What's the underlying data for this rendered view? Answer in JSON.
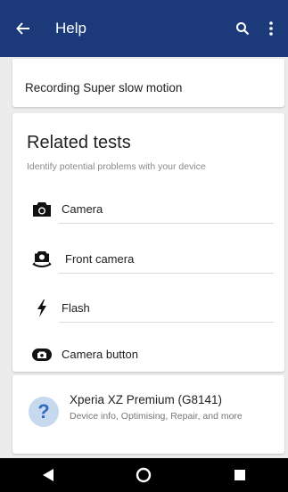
{
  "appbar": {
    "title": "Help",
    "color": "#1c3a7a",
    "icons": [
      "arrow-back-icon",
      "search-icon",
      "more-vert-icon"
    ]
  },
  "top_item": {
    "label": "Recording Super slow motion"
  },
  "related": {
    "heading": "Related tests",
    "subtitle": "Identify potential problems with your device",
    "items": [
      {
        "label": "Camera",
        "icon": "camera-icon"
      },
      {
        "label": "Front camera",
        "icon": "front-camera-icon"
      },
      {
        "label": "Flash",
        "icon": "flash-icon"
      },
      {
        "label": "Camera button",
        "icon": "camera-button-icon"
      }
    ]
  },
  "device": {
    "name": "Xperia XZ Premium (G8141)",
    "description": "Device info, Optimising, Repair, and more",
    "icon": "question-icon"
  },
  "navbar": {
    "icons": [
      "nav-back-icon",
      "nav-home-icon",
      "nav-recents-icon"
    ]
  }
}
